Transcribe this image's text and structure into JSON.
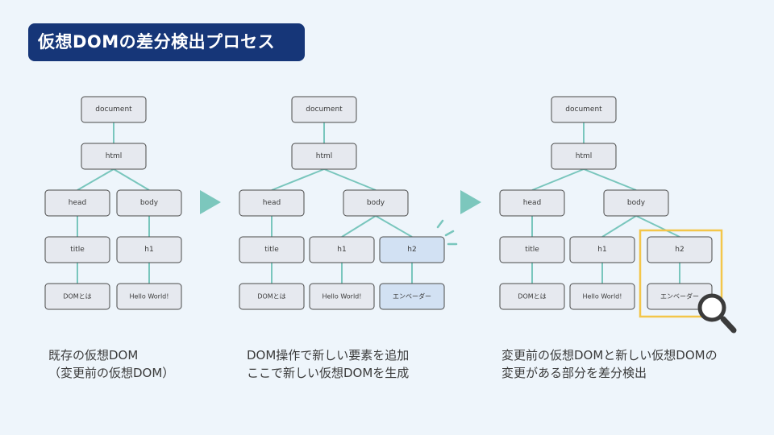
{
  "title": "仮想DOMの差分検出プロセス",
  "labels": {
    "document": "document",
    "html": "html",
    "head": "head",
    "body": "body",
    "title": "title",
    "h1": "h1",
    "h2": "h2",
    "dom_toha": "DOMとは",
    "hello_world": "Hello World!",
    "engineer": "エンベーダー"
  },
  "captions": {
    "panel1": [
      "既存の仮想DOM",
      "（変更前の仮想DOM）"
    ],
    "panel2": [
      "DOM操作で新しい要素を追加",
      "ここで新しい仮想DOMを生成"
    ],
    "panel3": [
      "変更前の仮想DOMと新しい仮想DOMの",
      "変更がある部分を差分検出"
    ]
  },
  "colors": {
    "title_bg": "#163678",
    "edge": "#79c6bd",
    "highlight_node": "#d2e1f3",
    "focus_box": "#f3c64a"
  },
  "icons": [
    "arrow-right-icon",
    "spark-icon",
    "magnifier-icon"
  ]
}
